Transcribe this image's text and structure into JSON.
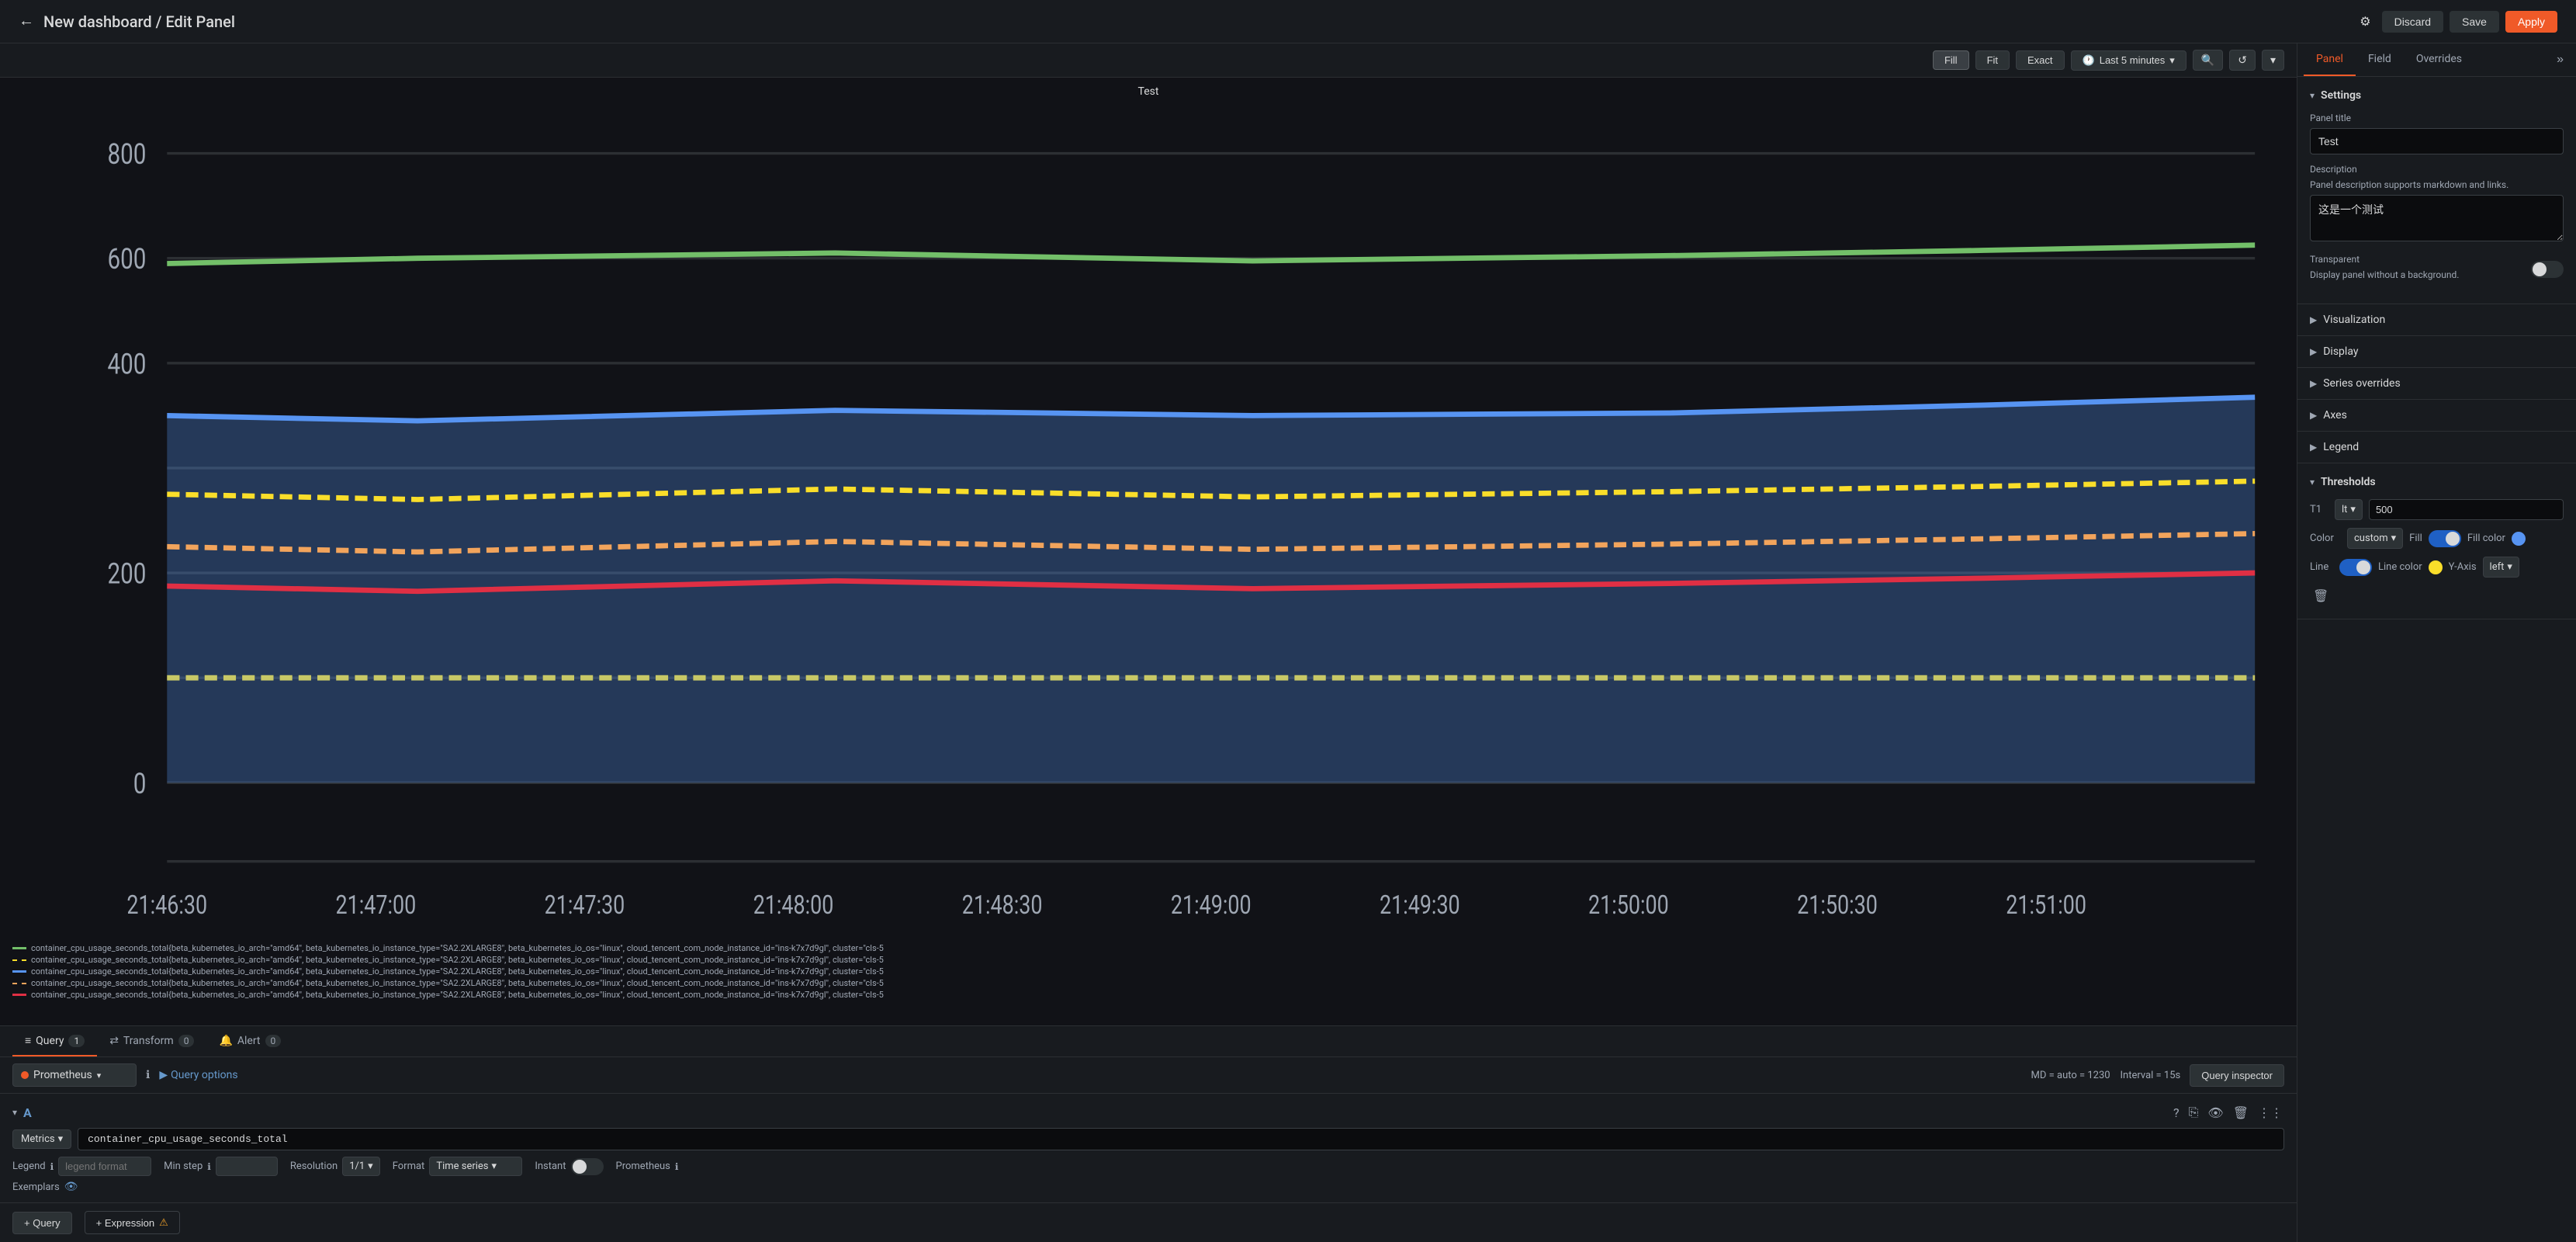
{
  "topbar": {
    "back_icon": "←",
    "title": "New dashboard / Edit Panel",
    "settings_icon": "⚙",
    "discard_label": "Discard",
    "save_label": "Save",
    "apply_label": "Apply"
  },
  "chart": {
    "toolbar": {
      "fill_label": "Fill",
      "fit_label": "Fit",
      "exact_label": "Exact",
      "time_icon": "🕐",
      "time_range": "Last 5 minutes",
      "search_icon": "🔍",
      "refresh_icon": "↺",
      "chevron": "▾"
    },
    "title": "Test",
    "y_axis": {
      "values": [
        "800",
        "600",
        "400",
        "200",
        "0"
      ]
    },
    "x_axis": {
      "values": [
        "21:46:30",
        "21:47:00",
        "21:47:30",
        "21:48:00",
        "21:48:30",
        "21:49:00",
        "21:49:30",
        "21:50:00",
        "21:50:30",
        "21:51:00"
      ]
    },
    "legend": {
      "items": [
        {
          "color": "#73bf69",
          "style": "solid",
          "text": "container_cpu_usage_seconds_total{beta_kubernetes_io_arch=\"amd64\", beta_kubernetes_io_instance_type=\"SA2.2XLARGE8\", beta_kubernetes_io_os=\"linux\", cloud_tencent_com_node_instance_id=\"ins-k7x7d9gl\", cluster=\"cls-5"
        },
        {
          "color": "#fade2a",
          "style": "dashed",
          "text": "container_cpu_usage_seconds_total{beta_kubernetes_io_arch=\"amd64\", beta_kubernetes_io_instance_type=\"SA2.2XLARGE8\", beta_kubernetes_io_os=\"linux\", cloud_tencent_com_node_instance_id=\"ins-k7x7d9gl\", cluster=\"cls-5"
        },
        {
          "color": "#5794f2",
          "style": "solid",
          "text": "container_cpu_usage_seconds_total{beta_kubernetes_io_arch=\"amd64\", beta_kubernetes_io_instance_type=\"SA2.2XLARGE8\", beta_kubernetes_io_os=\"linux\", cloud_tencent_com_node_instance_id=\"ins-k7x7d9gl\", cluster=\"cls-5"
        },
        {
          "color": "#f2a45c",
          "style": "dashed",
          "text": "container_cpu_usage_seconds_total{beta_kubernetes_io_arch=\"amd64\", beta_kubernetes_io_instance_type=\"SA2.2XLARGE8\", beta_kubernetes_io_os=\"linux\", cloud_tencent_com_node_instance_id=\"ins-k7x7d9gl\", cluster=\"cls-5"
        },
        {
          "color": "#e02f44",
          "style": "solid",
          "text": "container_cpu_usage_seconds_total{beta_kubernetes_io_arch=\"amd64\", beta_kubernetes_io_instance_type=\"SA2.2XLARGE8\", beta_kubernetes_io_os=\"linux\", cloud_tencent_com_node_instance_id=\"ins-k7x7d9gl\", cluster=\"cls-5"
        }
      ]
    }
  },
  "query_panel": {
    "tabs": [
      {
        "icon": "≡",
        "label": "Query",
        "badge": "1",
        "active": true
      },
      {
        "icon": "⇄",
        "label": "Transform",
        "badge": "0",
        "active": false
      },
      {
        "icon": "🔔",
        "label": "Alert",
        "badge": "0",
        "active": false
      }
    ],
    "datasource": {
      "name": "Prometheus",
      "dot_color": "#f05a28"
    },
    "md_info": "MD = auto = 1230",
    "interval_info": "Interval = 15s",
    "query_inspector_label": "Query inspector",
    "query_options_label": "Query options",
    "query_id": "A",
    "metrics_label": "Metrics",
    "metrics_value": "container_cpu_usage_seconds_total",
    "legend_label": "Legend",
    "legend_placeholder": "legend format",
    "min_step_label": "Min step",
    "resolution_label": "Resolution",
    "resolution_value": "1/1",
    "format_label": "Format",
    "format_value": "Time series",
    "instant_label": "Instant",
    "prometheus_label": "Prometheus",
    "exemplars_label": "Exemplars",
    "add_query_label": "+ Query",
    "add_expression_label": "+ Expression",
    "warn_icon": "⚠"
  },
  "right_panel": {
    "tabs": [
      "Panel",
      "Field",
      "Overrides"
    ],
    "active_tab": "Panel",
    "collapse_icon": "»",
    "settings": {
      "title": "Settings",
      "panel_title_label": "Panel title",
      "panel_title_value": "Test",
      "description_label": "Description",
      "description_helper": "Panel description supports markdown and links.",
      "description_value": "这是一个测试",
      "transparent_label": "Transparent",
      "transparent_helper": "Display panel without a background."
    },
    "visualization": {
      "title": "Visualization"
    },
    "display": {
      "title": "Display"
    },
    "series_overrides": {
      "title": "Series overrides"
    },
    "axes": {
      "title": "Axes"
    },
    "legend": {
      "title": "Legend"
    },
    "thresholds": {
      "title": "Thresholds",
      "t1_label": "T1",
      "t1_op": "lt",
      "t1_value": "500",
      "color_label": "Color",
      "color_value": "custom",
      "fill_label": "Fill",
      "fill_color_label": "Fill color",
      "fill_color": "#5794f2",
      "line_label": "Line",
      "line_color_label": "Line color",
      "line_color": "#fade2a",
      "y_axis_label": "Y-Axis",
      "y_axis_value": "left",
      "delete_icon": "🗑"
    }
  }
}
